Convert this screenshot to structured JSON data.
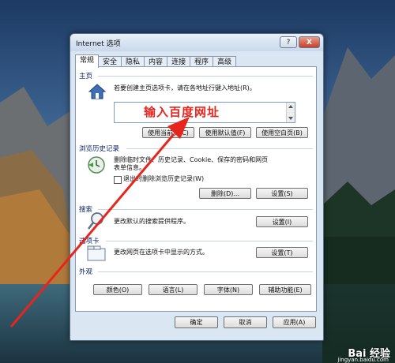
{
  "window": {
    "title": "Internet 选项",
    "help_label": "?",
    "close_label": "X"
  },
  "tabs": [
    {
      "label": "常规",
      "active": true
    },
    {
      "label": "安全",
      "active": false
    },
    {
      "label": "隐私",
      "active": false
    },
    {
      "label": "内容",
      "active": false
    },
    {
      "label": "连接",
      "active": false
    },
    {
      "label": "程序",
      "active": false
    },
    {
      "label": "高级",
      "active": false
    }
  ],
  "homepage": {
    "title": "主页",
    "desc": "若要创建主页选项卡，请在各地址行键入地址(R)。",
    "url_value": "",
    "btn_current": "使用当前页(C)",
    "btn_default": "使用默认值(F)",
    "btn_blank": "使用空白页(B)"
  },
  "annotation": "输入百度网址",
  "history": {
    "title": "浏览历史记录",
    "desc1": "删除临时文件、历史记录、Cookie、保存的密码和网页",
    "desc2": "表单信息。",
    "checkbox_label": "退出时删除浏览历史记录(W)",
    "checked": false,
    "btn_delete": "删除(D)...",
    "btn_settings": "设置(S)"
  },
  "search": {
    "title": "搜索",
    "desc": "更改默认的搜索提供程序。",
    "btn_settings": "设置(I)"
  },
  "tabs_section": {
    "title": "选项卡",
    "desc": "更改网页在选项卡中显示的方式。",
    "btn_settings": "设置(T)"
  },
  "appearance": {
    "title": "外观",
    "btn_colors": "颜色(O)",
    "btn_languages": "语言(L)",
    "btn_fonts": "字体(N)",
    "btn_accessibility": "辅助功能(E)"
  },
  "footer": {
    "ok": "确定",
    "cancel": "取消",
    "apply": "应用(A)"
  },
  "watermark": {
    "brand": "Bai 经验",
    "url": "jingyan.baidu.com"
  },
  "colors": {
    "annotation": "#e8251c",
    "section_title": "#0a246a"
  }
}
